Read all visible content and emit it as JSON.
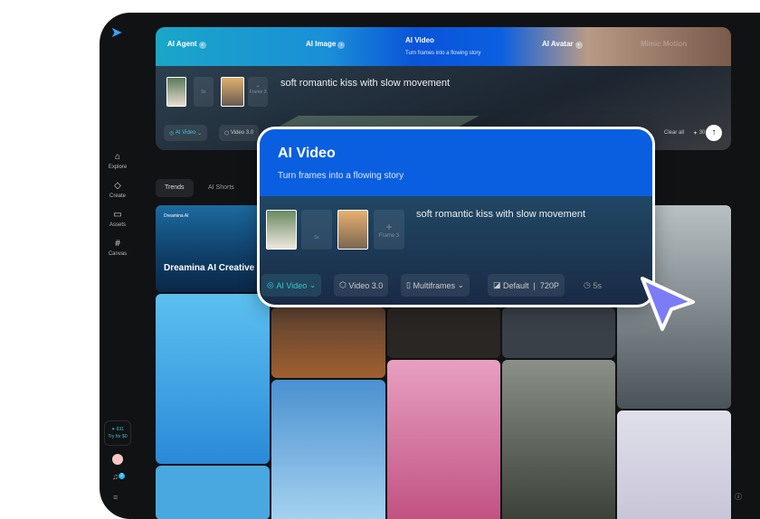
{
  "sidebar": {
    "nav": [
      {
        "label": "Explore",
        "icon": "home-icon"
      },
      {
        "label": "Create",
        "icon": "diamond-icon"
      },
      {
        "label": "Assets",
        "icon": "folder-icon"
      },
      {
        "label": "Canvas",
        "icon": "canvas-icon"
      }
    ],
    "credits": "631",
    "try_label": "Try for $0",
    "notifications": "2"
  },
  "banner": {
    "items": [
      "AI Agent",
      "AI Image",
      "AI Video",
      "AI Avatar",
      "Mimic Motion"
    ],
    "active_subtitle": "Turn frames into a flowing story"
  },
  "prompt": {
    "text": "soft romantic kiss with slow movement",
    "slot_duration": "5s",
    "slot_frame": "Frame 3",
    "mode": "AI Video",
    "model": "Video 3.0",
    "clear_all": "Clear all",
    "cost": "30"
  },
  "tabs": [
    "Trends",
    "AI Shorts"
  ],
  "featured": {
    "brand": "Dreamina AI",
    "title": "Dreamina AI Creative"
  },
  "card": {
    "title": "AI Video",
    "subtitle": "Turn frames into a flowing story",
    "prompt": "soft romantic kiss with slow movement",
    "slot_duration": "5s",
    "slot_frame": "Frame 3",
    "mode": "AI Video",
    "model": "Video 3.0",
    "frames": "Multiframes",
    "ratio": "Default",
    "resolution": "720P",
    "duration": "5s"
  },
  "colors": {
    "accent": "#0a5fe0",
    "teal": "#3ac6d6",
    "cursor": "#7b7cf6"
  }
}
